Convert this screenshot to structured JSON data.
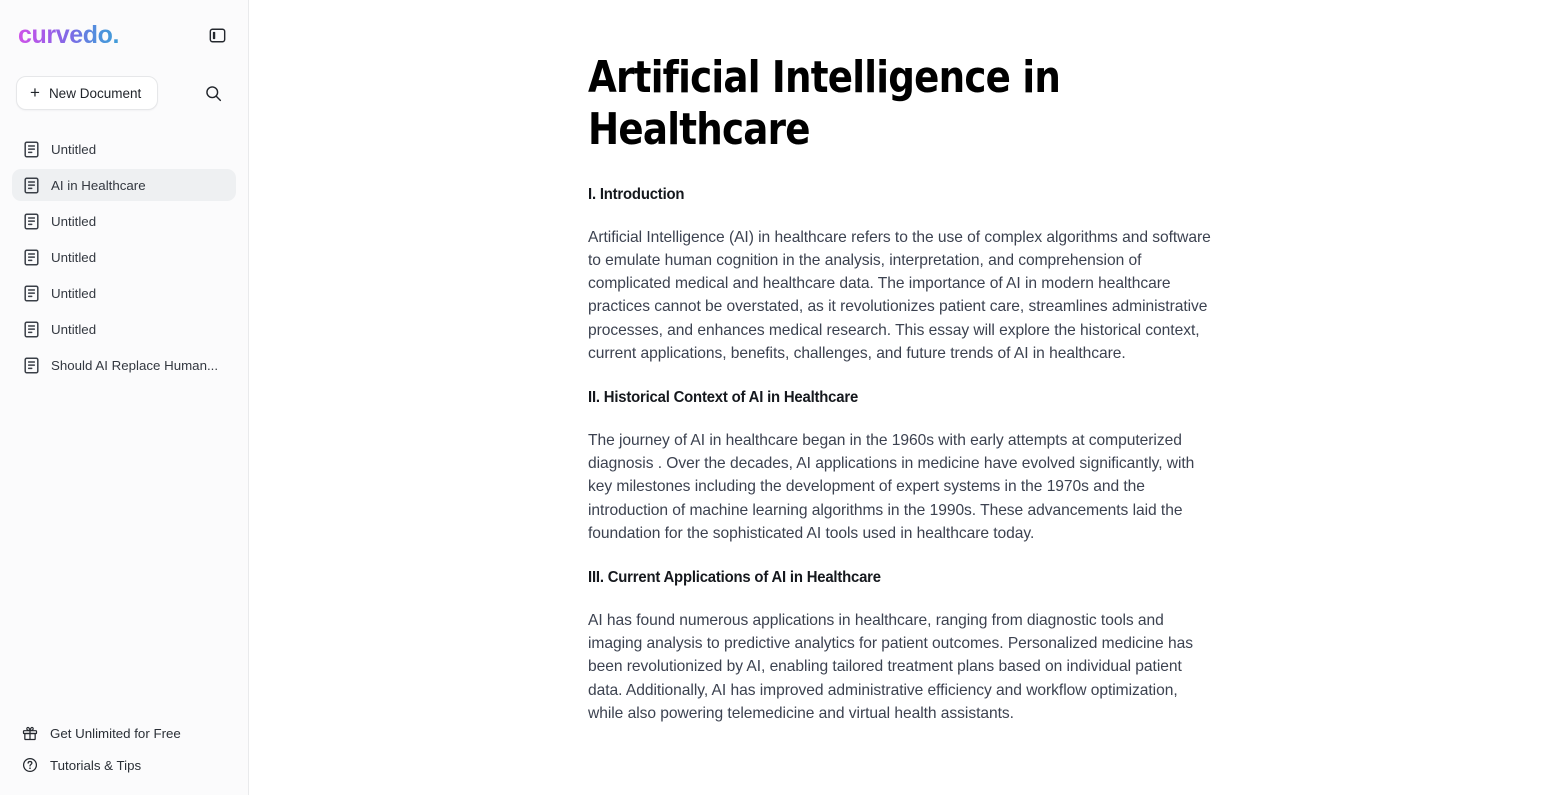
{
  "sidebar": {
    "logo": "curvedo.",
    "panel_toggle_icon": "sidebar-toggle-icon",
    "new_document_label": "New Document",
    "search_icon": "search-icon",
    "documents": [
      {
        "label": "Untitled",
        "active": false
      },
      {
        "label": "AI in Healthcare",
        "active": true
      },
      {
        "label": "Untitled",
        "active": false
      },
      {
        "label": "Untitled",
        "active": false
      },
      {
        "label": "Untitled",
        "active": false
      },
      {
        "label": "Untitled",
        "active": false
      },
      {
        "label": "Should AI Replace Human...",
        "active": false
      }
    ],
    "bottom_items": [
      {
        "label": "Get Unlimited for Free",
        "icon": "gift-icon"
      },
      {
        "label": "Tutorials & Tips",
        "icon": "help-circle-icon"
      }
    ]
  },
  "document": {
    "title": "Artificial Intelligence in Healthcare",
    "sections": [
      {
        "heading": "I. Introduction",
        "paragraph": "Artificial Intelligence (AI) in healthcare refers to the use of complex algorithms and software to emulate human cognition in the analysis, interpretation, and comprehension of complicated medical and healthcare data. The importance of AI in modern healthcare practices cannot be overstated, as it revolutionizes patient care, streamlines administrative processes, and enhances medical research. This essay will explore the historical context, current applications, benefits, challenges, and future trends of AI in healthcare."
      },
      {
        "heading": "II. Historical Context of AI in Healthcare",
        "paragraph": "The journey of AI in healthcare began in the 1960s with early attempts at computerized diagnosis . Over the decades, AI applications in medicine have evolved significantly, with key milestones including the development of expert systems in the 1970s and the introduction of machine learning algorithms in the 1990s. These advancements laid the foundation for the sophisticated AI tools used in healthcare today."
      },
      {
        "heading": "III. Current Applications of AI in Healthcare",
        "paragraph": "AI has found numerous applications in healthcare, ranging from diagnostic tools and imaging analysis to predictive analytics for patient outcomes. Personalized medicine has been revolutionized by AI, enabling tailored treatment plans based on individual patient data. Additionally, AI has improved administrative efficiency and workflow optimization, while also powering telemedicine and virtual health assistants."
      }
    ]
  },
  "colors": {
    "logo_gradient_start": "#cf52e8",
    "logo_gradient_end": "#3f9cd8",
    "sidebar_bg": "#fbfbfc",
    "active_item_bg": "#eef0f2",
    "body_text": "#3c4250",
    "heading_text": "#15181d"
  }
}
